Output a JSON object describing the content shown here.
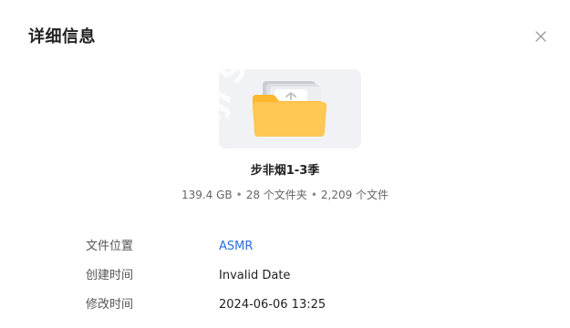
{
  "dialog": {
    "title": "详细信息",
    "close_icon": "close-icon"
  },
  "thumbnail": {
    "icon": "folder-icon",
    "watermark": "iiji S",
    "folder_color": "#ffc754",
    "background": "#f1f2f5"
  },
  "folder": {
    "name": "步非烟1-3季",
    "size": "139.4 GB",
    "folders": "28 个文件夹",
    "files": "2,209 个文件",
    "separator": "•"
  },
  "details": [
    {
      "label": "文件位置",
      "value": "ASMR",
      "is_link": true
    },
    {
      "label": "创建时间",
      "value": "Invalid Date",
      "is_link": false
    },
    {
      "label": "修改时间",
      "value": "2024-06-06 13:25",
      "is_link": false
    }
  ],
  "colors": {
    "link": "#2a6ede",
    "label": "#555555",
    "meta": "#666666"
  }
}
